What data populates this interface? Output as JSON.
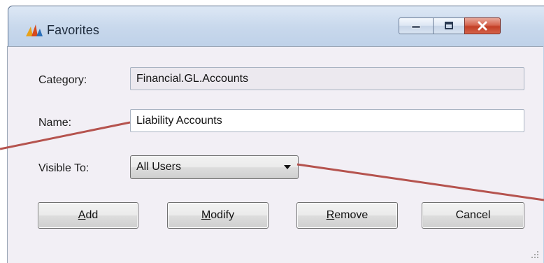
{
  "window": {
    "title": "Favorites",
    "app_icon": "bar-chart-icon",
    "caption_buttons": [
      "minimize-icon",
      "maximize-icon",
      "close-icon"
    ]
  },
  "form": {
    "category": {
      "label": "Category:",
      "value": "Financial.GL.Accounts"
    },
    "name": {
      "label": "Name:",
      "value": "Liability Accounts"
    },
    "visible_to": {
      "label": "Visible To:",
      "selected": "All Users"
    }
  },
  "buttons": {
    "add": {
      "accel": "A",
      "rest": "dd"
    },
    "modify": {
      "accel": "M",
      "rest": "odify"
    },
    "remove": {
      "accel": "R",
      "rest": "emove"
    },
    "cancel": {
      "label": "Cancel"
    }
  },
  "colors": {
    "callout_line": "#b5534e",
    "close_button": "#c8452c",
    "client_background": "#f2eff5"
  }
}
